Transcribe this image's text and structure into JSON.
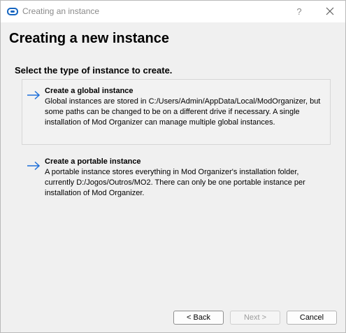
{
  "window": {
    "title": "Creating an instance",
    "help_label": "?"
  },
  "page": {
    "heading": "Creating a new instance",
    "subheading": "Select the type of instance to create."
  },
  "options": [
    {
      "title": "Create a global instance",
      "description": "Global instances are stored in C:/Users/Admin/AppData/Local/ModOrganizer, but some paths can be changed to be on a different drive if necessary. A single installation of Mod Organizer can manage multiple global instances."
    },
    {
      "title": "Create a portable instance",
      "description": "A portable instance stores everything in Mod Organizer's installation folder, currently D:/Jogos/Outros/MO2. There can only be one portable instance per installation of Mod Organizer."
    }
  ],
  "buttons": {
    "back": "< Back",
    "next": "Next >",
    "cancel": "Cancel"
  },
  "colors": {
    "arrow": "#1e6fd9",
    "titlebar_bg": "#ffffff",
    "dialog_bg": "#f0f0f0",
    "app_icon": "#1565c0"
  }
}
